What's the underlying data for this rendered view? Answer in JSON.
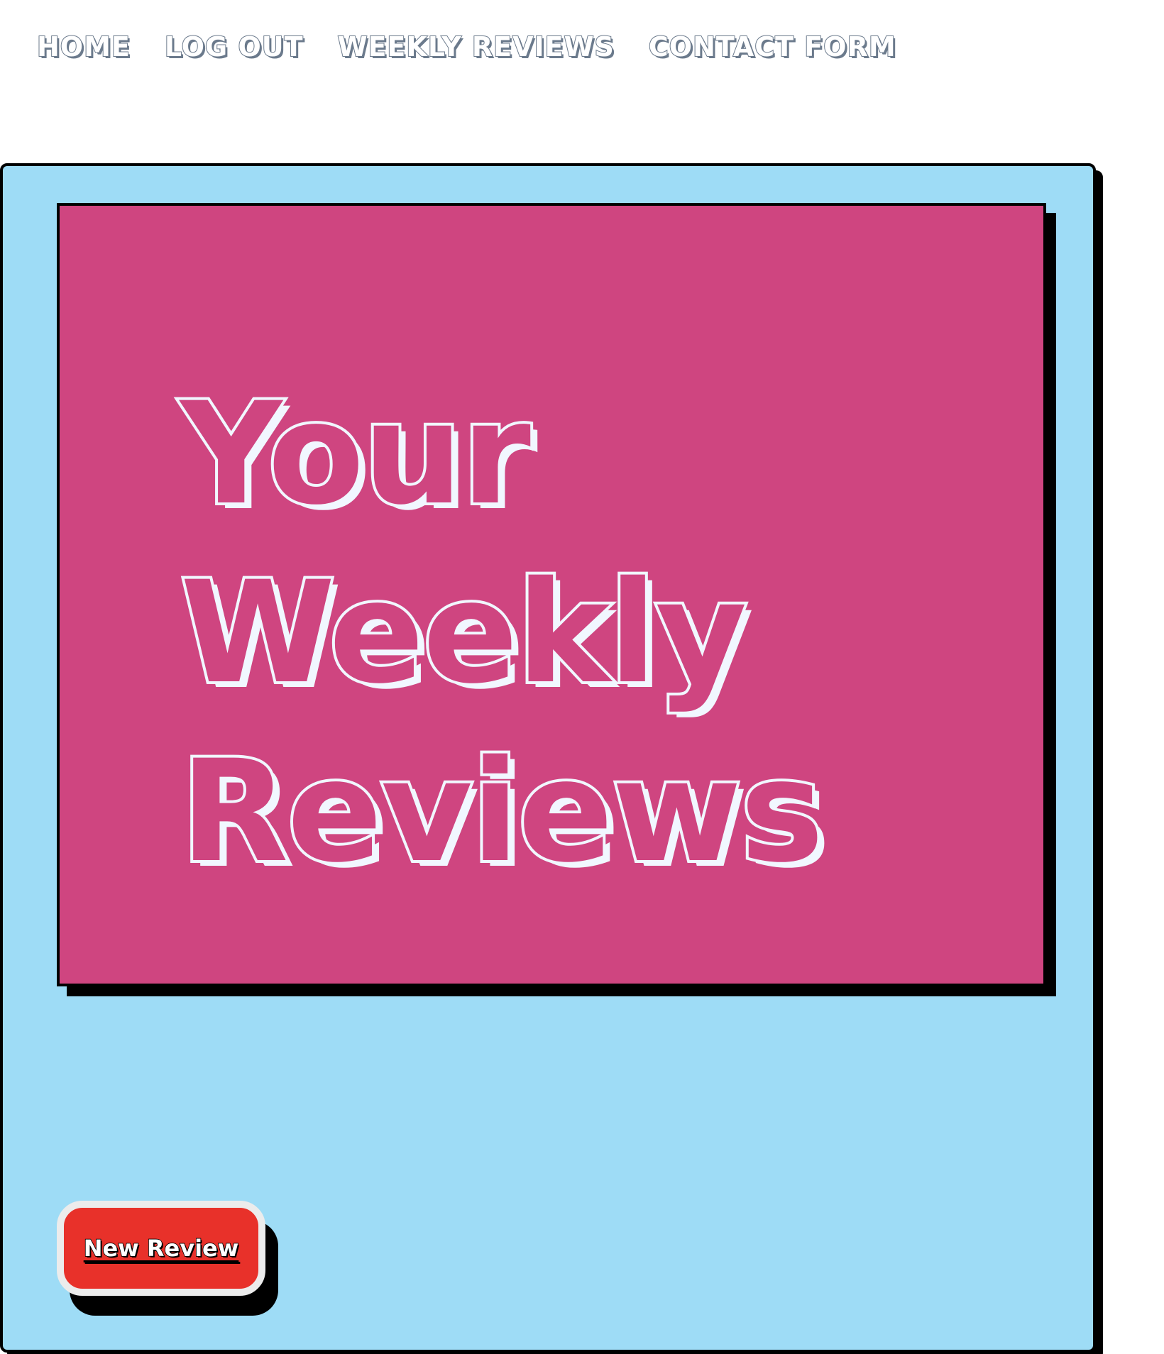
{
  "nav": {
    "items": [
      {
        "label": "HOME"
      },
      {
        "label": "LOG OUT"
      },
      {
        "label": "WEEKLY REVIEWS"
      },
      {
        "label": "CONTACT FORM"
      }
    ]
  },
  "hero": {
    "title_lines": [
      "Your",
      "Weekly",
      "Reviews"
    ]
  },
  "actions": {
    "new_review_label": "New Review"
  },
  "colors": {
    "panel_background": "#9edcf6",
    "hero_background": "#cf4580",
    "button_background": "#e8312a",
    "title_text": "#f1f7ff",
    "nav_outline": "#6b7a8c"
  }
}
